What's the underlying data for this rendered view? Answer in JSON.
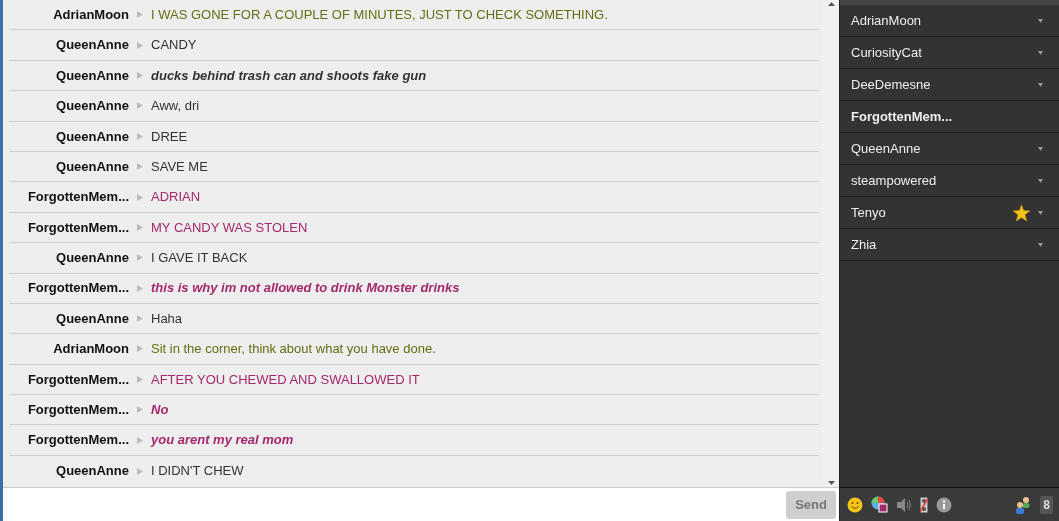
{
  "messages": [
    {
      "name": "AdrianMoon",
      "text": "I WAS GONE FOR A COUPLE OF MINUTES, JUST TO CHECK SOMETHING.",
      "color": "#666d12",
      "kind": "normal"
    },
    {
      "name": "QueenAnne",
      "text": "CANDY",
      "color": "#333333",
      "kind": "normal"
    },
    {
      "name": "QueenAnne",
      "text": "ducks behind trash can and shoots fake gun",
      "color": "#333333",
      "kind": "action"
    },
    {
      "name": "QueenAnne",
      "text": "Aww, dri",
      "color": "#333333",
      "kind": "normal"
    },
    {
      "name": "QueenAnne",
      "text": "DREE",
      "color": "#333333",
      "kind": "normal"
    },
    {
      "name": "QueenAnne",
      "text": "SAVE ME",
      "color": "#333333",
      "kind": "normal"
    },
    {
      "name": "ForgottenMem...",
      "text": "ADRIAN",
      "color": "#a4286e",
      "kind": "normal"
    },
    {
      "name": "ForgottenMem...",
      "text": "MY CANDY WAS STOLEN",
      "color": "#a4286e",
      "kind": "normal"
    },
    {
      "name": "QueenAnne",
      "text": "I GAVE IT BACK",
      "color": "#333333",
      "kind": "normal"
    },
    {
      "name": "ForgottenMem...",
      "text": "this is why im not allowed to drink Monster drinks",
      "color": "#a4286e",
      "kind": "action"
    },
    {
      "name": "QueenAnne",
      "text": "Haha",
      "color": "#333333",
      "kind": "normal"
    },
    {
      "name": "AdrianMoon",
      "text": "Sit in the corner, think about what you have done.",
      "color": "#666d12",
      "kind": "normal"
    },
    {
      "name": "ForgottenMem...",
      "text": "AFTER YOU CHEWED AND SWALLOWED IT",
      "color": "#a4286e",
      "kind": "normal"
    },
    {
      "name": "ForgottenMem...",
      "text": "No",
      "color": "#a4286e",
      "kind": "action"
    },
    {
      "name": "ForgottenMem...",
      "text": "you arent my real mom",
      "color": "#a4286e",
      "kind": "action"
    },
    {
      "name": "QueenAnne",
      "text": "I DIDN'T CHEW",
      "color": "#333333",
      "kind": "normal"
    }
  ],
  "send_button": "Send",
  "users": [
    {
      "name": "AdrianMoon",
      "selected": false,
      "starred": false
    },
    {
      "name": "CuriosityCat",
      "selected": false,
      "starred": false
    },
    {
      "name": "DeeDemesne",
      "selected": false,
      "starred": false
    },
    {
      "name": "ForgottenMem...",
      "selected": true,
      "starred": false
    },
    {
      "name": "QueenAnne",
      "selected": false,
      "starred": false
    },
    {
      "name": "steampowered",
      "selected": false,
      "starred": false
    },
    {
      "name": "Tenyo",
      "selected": false,
      "starred": true
    },
    {
      "name": "Zhia",
      "selected": false,
      "starred": false
    }
  ],
  "user_count": "8"
}
